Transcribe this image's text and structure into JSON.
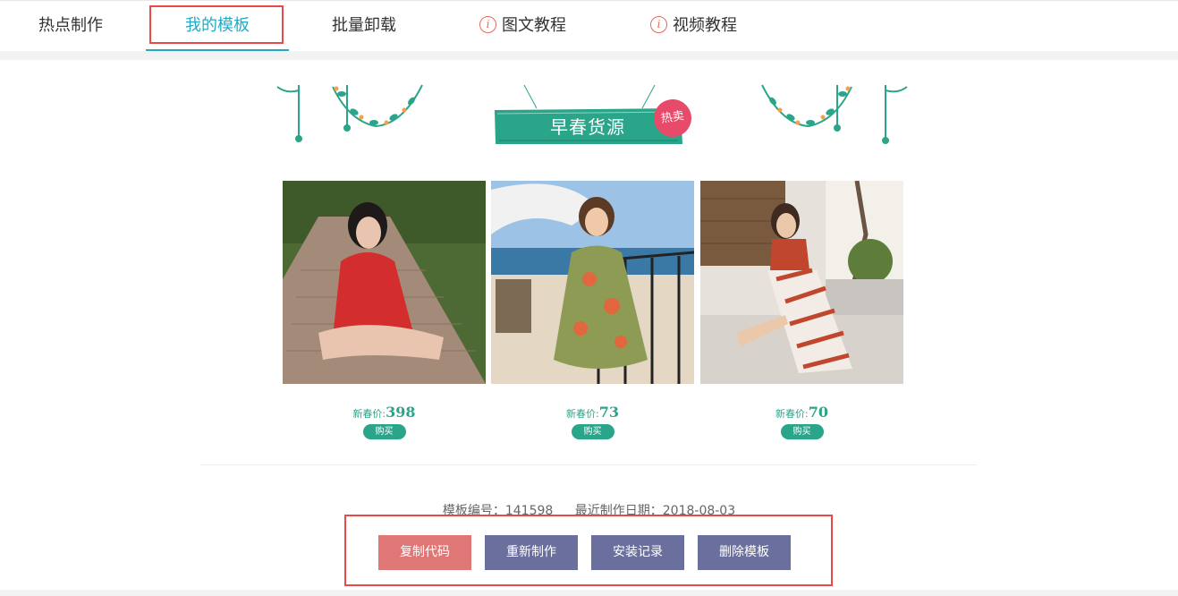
{
  "tabs": [
    {
      "label": "热点制作"
    },
    {
      "label": "我的模板"
    },
    {
      "label": "批量卸载"
    },
    {
      "label": "图文教程",
      "icon": "info-icon"
    },
    {
      "label": "视频教程",
      "icon": "info-icon"
    }
  ],
  "banner": {
    "title": "早春货源",
    "badge": "热卖"
  },
  "products": [
    {
      "price_label": "新春价:",
      "price": "398",
      "buy_label": "购买"
    },
    {
      "price_label": "新春价:",
      "price": "73",
      "buy_label": "购买"
    },
    {
      "price_label": "新春价:",
      "price": "70",
      "buy_label": "购买"
    }
  ],
  "meta": {
    "template_id": "模板编号：141598",
    "last_date": "最近制作日期：2018-08-03"
  },
  "actions": {
    "copy": "复制代码",
    "remake": "重新制作",
    "install_log": "安装记录",
    "delete": "删除模板"
  },
  "colors": {
    "accent": "#27a9c4",
    "highlight": "#e84a4a",
    "teal": "#2aa58a",
    "copy_button": "#e07777",
    "action_button": "#6b6f9d"
  }
}
